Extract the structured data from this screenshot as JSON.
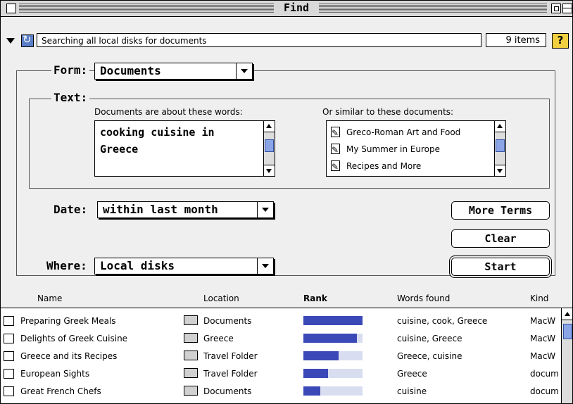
{
  "window": {
    "title": "Find"
  },
  "status": {
    "message": "Searching all local disks for documents",
    "count": "9 items",
    "help": "?"
  },
  "form": {
    "label": "Form:",
    "value": "Documents"
  },
  "text": {
    "label": "Text:",
    "words_label": "Documents are about these words:",
    "words": [
      "cooking cuisine in",
      "Greece"
    ],
    "similar_label": "Or similar to these documents:",
    "similar": [
      "Greco-Roman Art and Food",
      "My Summer in Europe",
      "Recipes and More"
    ]
  },
  "date": {
    "label": "Date:",
    "value": "within last month"
  },
  "where": {
    "label": "Where:",
    "value": "Local disks"
  },
  "buttons": {
    "more_terms": "More Terms",
    "clear": "Clear",
    "start": "Start"
  },
  "results": {
    "columns": [
      "Name",
      "Location",
      "Rank",
      "Words found",
      "Kind"
    ],
    "rows": [
      {
        "name": "Preparing Greek Meals",
        "location": "Documents",
        "rank": 1.0,
        "words": "cuisine, cook, Greece",
        "kind": "MacW"
      },
      {
        "name": "Delights of Greek Cuisine",
        "location": "Greece",
        "rank": 0.9,
        "words": "cuisine, Greece",
        "kind": "MacW"
      },
      {
        "name": "Greece and its Recipes",
        "location": "Travel Folder",
        "rank": 0.6,
        "words": "Greece, cuisine",
        "kind": "MacW"
      },
      {
        "name": "European Sights",
        "location": "Travel Folder",
        "rank": 0.42,
        "words": "Greece",
        "kind": "docum"
      },
      {
        "name": "Great French Chefs",
        "location": "Documents",
        "rank": 0.28,
        "words": "cuisine",
        "kind": "docum"
      }
    ]
  }
}
